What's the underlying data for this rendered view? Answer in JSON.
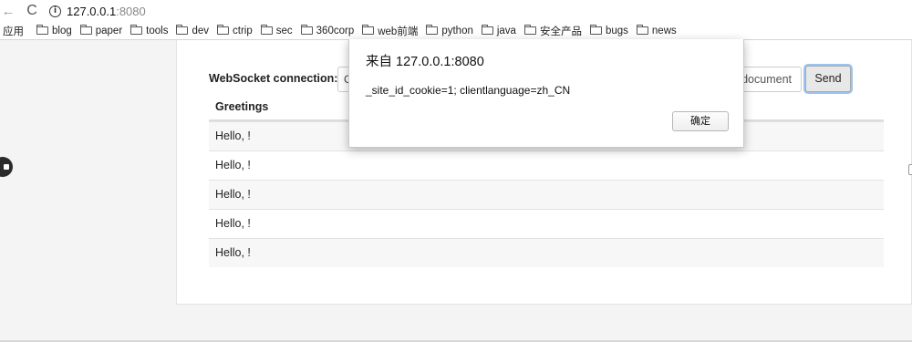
{
  "browser": {
    "back_icon": "←",
    "forward_icon": "→",
    "reload_icon": "C",
    "info_icon": "i",
    "url_host": "127.0.0.1",
    "url_port": ":8080"
  },
  "bookmarks": {
    "apps_label": "应用",
    "items": [
      "blog",
      "paper",
      "tools",
      "dev",
      "ctrip",
      "sec",
      "360corp",
      "web前端",
      "python",
      "java",
      "安全产品",
      "bugs",
      "news"
    ]
  },
  "page": {
    "ws_label": "WebSocket connection:",
    "connect_partial": "C",
    "doc_field_value": "document",
    "send_label": "Send",
    "table_header": "Greetings",
    "rows": [
      "Hello, !",
      "Hello, !",
      "Hello, !",
      "Hello, !",
      "Hello, !"
    ]
  },
  "dialog": {
    "title": "来自 127.0.0.1:8080",
    "message": "_site_id_cookie=1; clientlanguage=zh_CN",
    "ok_label": "确定"
  }
}
